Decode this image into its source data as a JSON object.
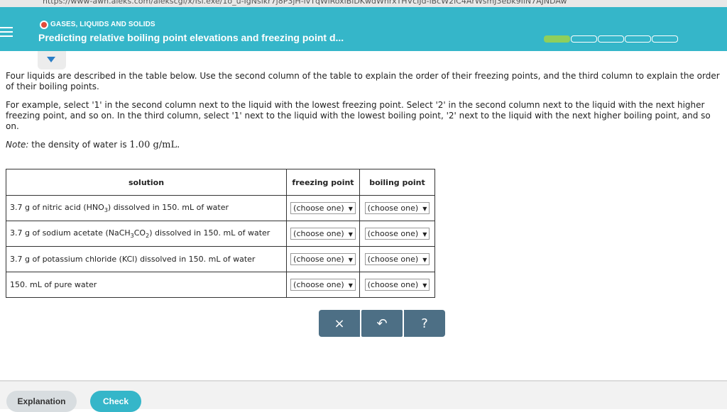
{
  "browser": {
    "url_fragment": "https://www-awn.aleks.com/alekscgi/x/Isl.exe/1o_u-IgNslkr7j8P3jH-lvTqWiRoxlBiDKwdWhrxTHVcIJd-lBcW2iC4ArWsmJ3ebk9IiN7AJNDAw"
  },
  "header": {
    "section": "GASES, LIQUIDS AND SOLIDS",
    "title": "Predicting relative boiling point elevations and freezing point d...",
    "progress": {
      "done": 1,
      "total": 5
    },
    "accent": "#35b6c9",
    "progress_done_color": "#8fcf5b",
    "section_dot_color": "#e24b3b"
  },
  "content": {
    "intro": "Four liquids are described in the table below. Use the second column of the table to explain the order of their freezing points, and the third column to explain the order of their boiling points.",
    "example": "For example, select '1' in the second column next to the liquid with the lowest freezing point. Select '2' in the second column next to the liquid with the next higher freezing point, and so on. In the third column, select '1' next to the liquid with the lowest boiling point, '2' next to the liquid with the next higher boiling point, and so on.",
    "note_label": "Note:",
    "note_text": "the density of water is",
    "note_value": "1.00 g/mL."
  },
  "table": {
    "headers": [
      "solution",
      "freezing point",
      "boiling point"
    ],
    "rows": [
      {
        "pre": "3.7 g of nitric acid (HNO",
        "sub": "3",
        "post": ") dissolved in 150. mL of water",
        "freezing": "(choose one)",
        "boiling": "(choose one)"
      },
      {
        "pre": "3.7 g of sodium acetate (NaCH",
        "sub": "3",
        "mid": "CO",
        "sub2": "2",
        "post": ") dissolved in 150. mL of water",
        "freezing": "(choose one)",
        "boiling": "(choose one)"
      },
      {
        "pre": "3.7 g of potassium chloride (KCl) dissolved in 150. mL of water",
        "freezing": "(choose one)",
        "boiling": "(choose one)"
      },
      {
        "pre": "150. mL of pure water",
        "freezing": "(choose one)",
        "boiling": "(choose one)"
      }
    ]
  },
  "actions": {
    "clear": "×",
    "undo": "↶",
    "help": "?",
    "color": "#4d6f85"
  },
  "footer": {
    "explanation": "Explanation",
    "check": "Check"
  }
}
